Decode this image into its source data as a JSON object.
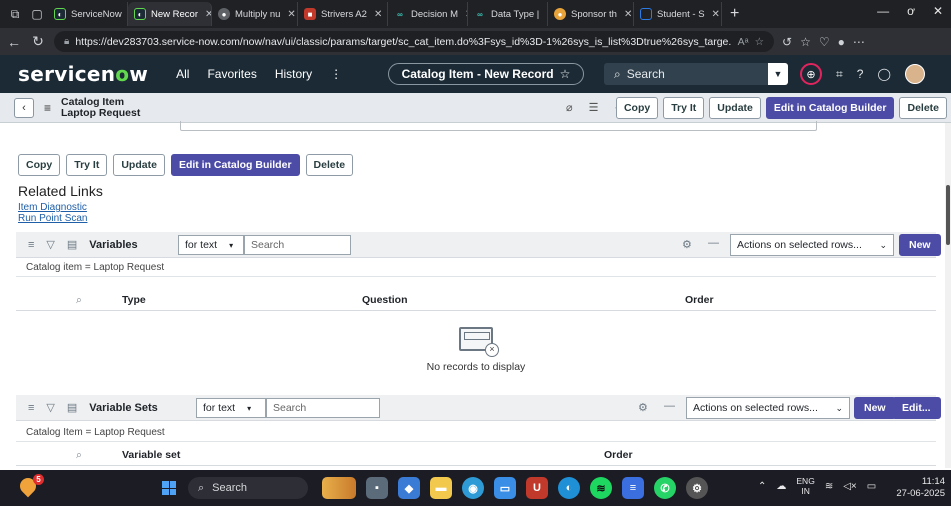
{
  "browser": {
    "tabs": [
      {
        "label": "ServiceNow",
        "color": "#1b2a35",
        "glyph": "◐",
        "active": false
      },
      {
        "label": "New Recor",
        "color": "#1b2a35",
        "glyph": "◐",
        "active": true
      },
      {
        "label": "Multiply nu",
        "color": "#5f6368",
        "glyph": "●",
        "active": false
      },
      {
        "label": "Strivers A2",
        "color": "#c0392b",
        "glyph": "■",
        "active": false
      },
      {
        "label": "Decision M",
        "color": "#0b7a75",
        "glyph": "∞",
        "active": false
      },
      {
        "label": "Data Type |",
        "color": "#0b7a75",
        "glyph": "∞",
        "active": false
      },
      {
        "label": "Sponsor th",
        "color": "#e8a33a",
        "glyph": "●",
        "active": false
      },
      {
        "label": "Student - S",
        "color": "#2d7be5",
        "glyph": "□",
        "active": false
      }
    ],
    "url": "https://dev283703.service-now.com/now/nav/ui/classic/params/target/sc_cat_item.do%3Fsys_id%3D-1%26sys_is_list%3Dtrue%26sys_targe..."
  },
  "sn_header": {
    "logo_text": "servicen",
    "logo_o": "o",
    "logo_end": "w",
    "nav": [
      "All",
      "Favorites",
      "History",
      "⋮"
    ],
    "record_label": "Catalog Item - New Record",
    "search_placeholder": "Search"
  },
  "form_header": {
    "title_line1": "Catalog Item",
    "title_line2": "Laptop Request",
    "buttons": {
      "copy": "Copy",
      "try_it": "Try It",
      "update": "Update",
      "edit_builder": "Edit in Catalog Builder",
      "delete": "Delete"
    }
  },
  "bottom_buttons": {
    "copy": "Copy",
    "try_it": "Try It",
    "update": "Update",
    "edit_builder": "Edit in Catalog Builder",
    "delete": "Delete"
  },
  "related_links": {
    "title": "Related Links",
    "links": [
      "Item Diagnostic",
      "Run Point Scan"
    ]
  },
  "variables_list": {
    "title": "Variables",
    "filter_field": "for text",
    "search_placeholder": "Search",
    "actions": "Actions on selected rows...",
    "new_label": "New",
    "condition": "Catalog item = Laptop Request",
    "columns": [
      "Type",
      "Question",
      "Order"
    ],
    "empty_text": "No records to display"
  },
  "variable_sets_list": {
    "title": "Variable Sets",
    "filter_field": "for text",
    "search_placeholder": "Search",
    "actions": "Actions on selected rows...",
    "new_label": "New",
    "edit_label": "Edit...",
    "condition": "Catalog Item = Laptop Request",
    "columns": [
      "Variable set",
      "Order"
    ]
  },
  "taskbar": {
    "badge": "5",
    "search_label": "Search",
    "lang_line1": "ENG",
    "lang_line2": "IN",
    "time": "11:14",
    "date": "27-06-2025"
  }
}
